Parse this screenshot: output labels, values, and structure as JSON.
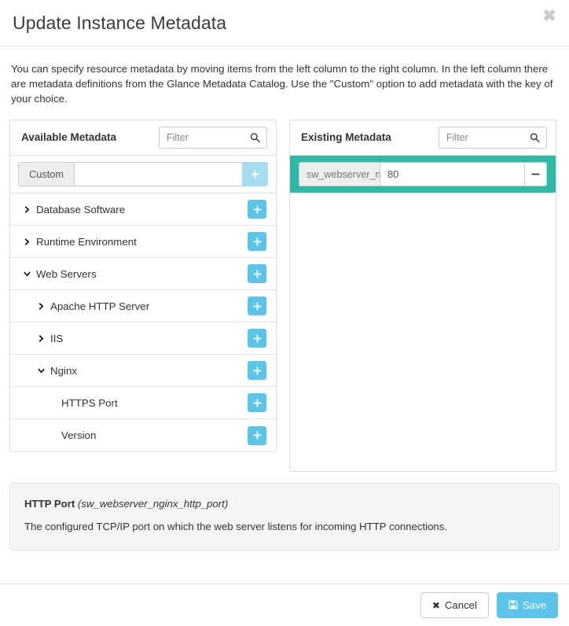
{
  "header": {
    "title": "Update Instance Metadata",
    "close_label": "✖"
  },
  "intro": "You can specify resource metadata by moving items from the left column to the right column. In the left column there are metadata definitions from the Glance Metadata Catalog. Use the \"Custom\" option to add metadata with the key of your choice.",
  "available": {
    "title": "Available Metadata",
    "filter_placeholder": "Filter",
    "filter_value": "",
    "custom": {
      "label": "Custom",
      "input_value": "",
      "input_placeholder": "",
      "add_label": "+"
    },
    "items": [
      {
        "label": "Database Software",
        "level": 0,
        "caret": "right",
        "add_label": "+"
      },
      {
        "label": "Runtime Environment",
        "level": 0,
        "caret": "right",
        "add_label": "+"
      },
      {
        "label": "Web Servers",
        "level": 0,
        "caret": "down",
        "add_label": "+"
      },
      {
        "label": "Apache HTTP Server",
        "level": 1,
        "caret": "right",
        "add_label": "+"
      },
      {
        "label": "IIS",
        "level": 1,
        "caret": "right",
        "add_label": "+"
      },
      {
        "label": "Nginx",
        "level": 1,
        "caret": "down",
        "add_label": "+"
      },
      {
        "label": "HTTPS Port",
        "level": 2,
        "caret": "none",
        "add_label": "+"
      },
      {
        "label": "Version",
        "level": 2,
        "caret": "none",
        "add_label": "+"
      }
    ]
  },
  "existing": {
    "title": "Existing Metadata",
    "filter_placeholder": "Filter",
    "filter_value": "",
    "items": [
      {
        "key": "sw_webserver_nginx...",
        "value": "80",
        "remove_label": "−",
        "highlighted": true
      }
    ]
  },
  "info": {
    "name": "HTTP Port",
    "key": "(sw_webserver_nginx_http_port)",
    "description": "The configured TCP/IP port on which the web server listens for incoming HTTP connections."
  },
  "footer": {
    "cancel_label": "Cancel",
    "save_label": "Save"
  },
  "colors": {
    "accent_blue": "#5bc4e7",
    "accent_blue_disabled": "#a6dcef",
    "highlight_teal": "#2eb8a6",
    "panel_border": "#dddddd",
    "info_bg": "#f5f5f5"
  }
}
